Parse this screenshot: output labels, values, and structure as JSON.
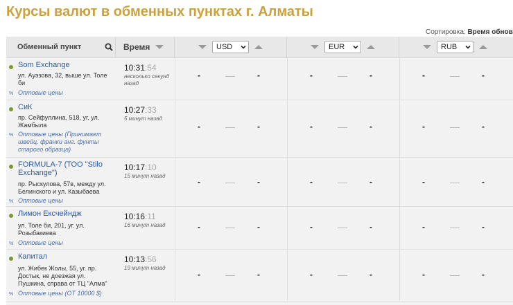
{
  "page": {
    "title": "Курсы валют в обменных пунктах г. Алматы",
    "sort_label": "Сортировка:",
    "sort_value": "Время обнов"
  },
  "table": {
    "col_name": "Обменный пункт",
    "col_time": "Время",
    "currencies": [
      "USD",
      "EUR",
      "RUB"
    ],
    "empty_value": "-"
  },
  "rows": [
    {
      "name": "Som Exchange",
      "address": "ул. Ауэзова, 32, выше ул. Толе би",
      "wholesale": "Оптовые цены",
      "time": "10:31",
      "seconds": ":54",
      "ago": "несколько секунд назад"
    },
    {
      "name": "СиК",
      "address": "пр. Сейфуллина, 518, уг. ул. Жамбыла",
      "wholesale": "Оптовые цены (Принимает швейц. франки анг. фунты старого образца)",
      "time": "10:27",
      "seconds": ":33",
      "ago": "5 минут назад"
    },
    {
      "name": "FORMULA-7 (ТОО \"Stilo Exchange\")",
      "address": "пр. Рыскулова, 57в, между ул. Белинского и ул. Казыбаева",
      "wholesale": "Оптовые цены",
      "time": "10:17",
      "seconds": ":10",
      "ago": "15 минут назад"
    },
    {
      "name": "Лимон Ексчейндж",
      "address": "ул. Толе би, 201, уг. ул. Розыбакиева",
      "wholesale": "Оптовые цены",
      "time": "10:16",
      "seconds": ":11",
      "ago": "16 минут назад"
    },
    {
      "name": "Капитал",
      "address": "ул. Жибек Жолы, 55, уг. пр. Достык, не доезжая ул. Пушкина, справа от ТЦ \"Алма\"",
      "wholesale": "Оптовые цены (ОТ 10000 $)",
      "time": "10:13",
      "seconds": ":56",
      "ago": "19 минут назад"
    }
  ],
  "colors": {
    "title": "#c9a23c",
    "link": "#2a5a9f",
    "status_dot": "#7a9a2e",
    "header_bg": "#e8e8e8",
    "row_bg": "#f2f2f2"
  }
}
